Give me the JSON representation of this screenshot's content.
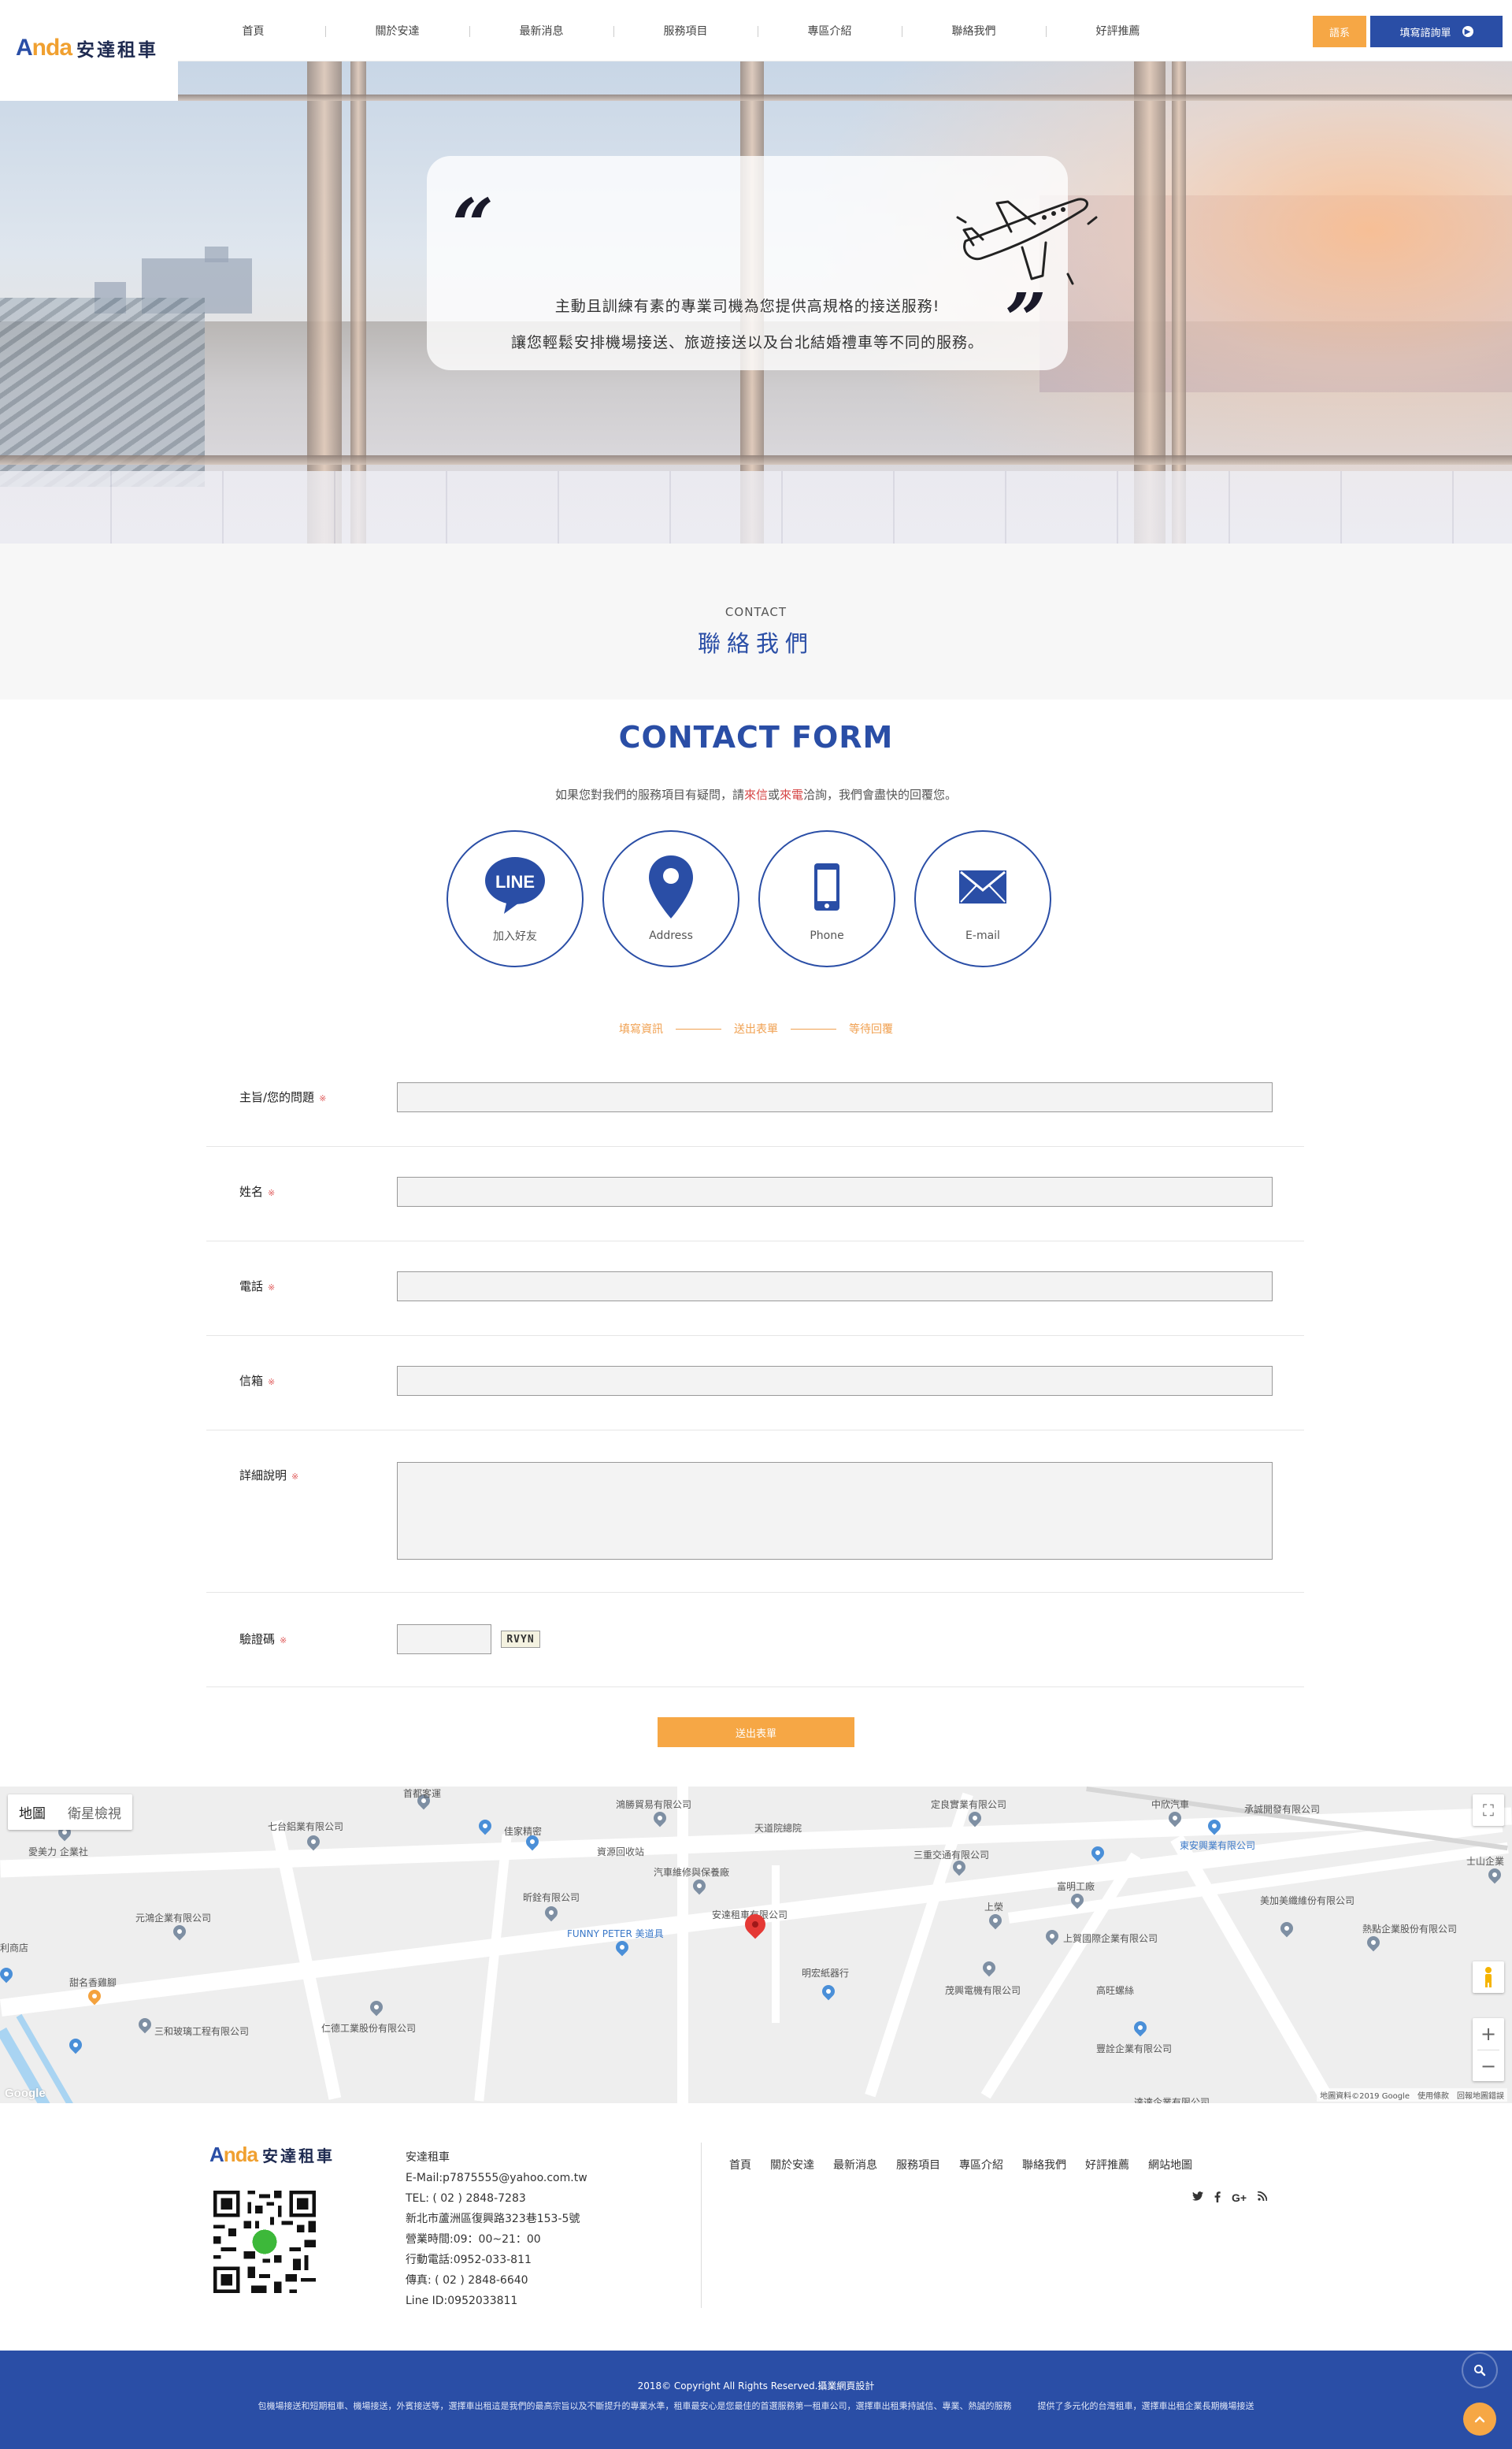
{
  "header": {
    "brand_en_a": "A",
    "brand_en_rest": "nda",
    "brand_zh": "安達租車",
    "nav": [
      "首頁",
      "關於安達",
      "最新消息",
      "服務項目",
      "專區介紹",
      "聯絡我們",
      "好評推薦"
    ],
    "lang_button": "語系",
    "inquiry_button": "填寫諮詢單"
  },
  "hero": {
    "line1": "主動且訓練有素的專業司機為您提供高規格的接送服務!",
    "line2": "讓您輕鬆安排機場接送、旅遊接送以及台北結婚禮車等不同的服務。",
    "open_quote": "“",
    "close_quote": "”"
  },
  "section": {
    "en": "CONTACT",
    "zh": "聯絡我們"
  },
  "contact_form": {
    "title": "CONTACT FORM",
    "intro_before": "如果您對我們的服務項目有疑問，請",
    "intro_hl1": "來信",
    "intro_mid": "或",
    "intro_hl2": "來電",
    "intro_after": "洽詢，我們會盡快的回覆您。",
    "icons": [
      {
        "label": "加入好友",
        "icon": "line-icon"
      },
      {
        "label": "Address",
        "icon": "map-pin-icon"
      },
      {
        "label": "Phone",
        "icon": "phone-icon"
      },
      {
        "label": "E-mail",
        "icon": "mail-icon"
      }
    ],
    "icon_line_text": "LINE",
    "steps": [
      "填寫資訊",
      "送出表單",
      "等待回覆"
    ],
    "fields": [
      {
        "label": "主旨/您的問題",
        "req": "※"
      },
      {
        "label": "姓名",
        "req": "※"
      },
      {
        "label": "電話",
        "req": "※"
      },
      {
        "label": "信箱",
        "req": "※"
      },
      {
        "label": "詳細說明",
        "req": "※"
      }
    ],
    "captcha_label": "驗證碼",
    "captcha_req": "※",
    "captcha_code": "RVYN",
    "submit": "送出表單"
  },
  "map": {
    "type_map": "地圖",
    "type_satellite": "衛星檢視",
    "pois": [
      "首都客運",
      "鴻勝貿易有限公司",
      "定良實業有限公司",
      "中欣汽車",
      "承誠開發有限公司",
      "七台鋁業有限公司",
      "佳家精密",
      "天道院總院",
      "東安興業有限公司",
      "士山企業",
      "愛美力 企業社",
      "資源回收站",
      "三重交通有限公司",
      "汽車維修與保養廠",
      "富明工廠",
      "美加美纖維份有限公司",
      "元鴻企業有限公司",
      "昕銓有限公司",
      "安達租車有限公司",
      "上榮",
      "熱點企業股份有限公司",
      "FUNNY PETER 美道具",
      "上賀國際企業有限公司",
      "利商店",
      "甜名香雞腳",
      "明宏紙器行",
      "茂興電機有限公司",
      "高旺螺絲",
      "三和玻璃工程有限公司",
      "仁德工業股份有限公司",
      "豐詮企業有限公司",
      "達達企業有限公司"
    ],
    "attribution": "地圖資料©2019 Google",
    "terms": "使用條款",
    "report": "回報地圖錯誤",
    "google": "Google"
  },
  "footer": {
    "brand_zh": "安達租車",
    "info": [
      "安達租車",
      "E-Mail:p7875555@yahoo.com.tw",
      "TEL: ( 02 ) 2848-7283",
      "新北市蘆洲區復興路323巷153-5號",
      "營業時間:09：00~21：00",
      "行動電話:0952-033-811",
      "傳真: ( 02 ) 2848-6640",
      "Line ID:0952033811"
    ],
    "nav": [
      "首頁",
      "關於安達",
      "最新消息",
      "服務項目",
      "專區介紹",
      "聯絡我們",
      "好評推薦",
      "網站地圖"
    ],
    "copyright": "2018© Copyright All Rights Reserved.",
    "copyright_link": "攝業網頁設計",
    "description": "包機場接送和短期租車、機場接送，外賓接送等，選擇車出租這是我們的最高宗旨以及不斷提升的專業水準，租車最安心是您最佳的首選服務第一租車公司，選擇車出租秉持誠信、專業、熱誠的服務　　　提供了多元化的台灣租車，選擇車出租企業長期機場接送"
  },
  "colors": {
    "brand_blue": "#2a4ea6",
    "accent_orange": "#f6a745",
    "required_red": "#e05c5c"
  }
}
